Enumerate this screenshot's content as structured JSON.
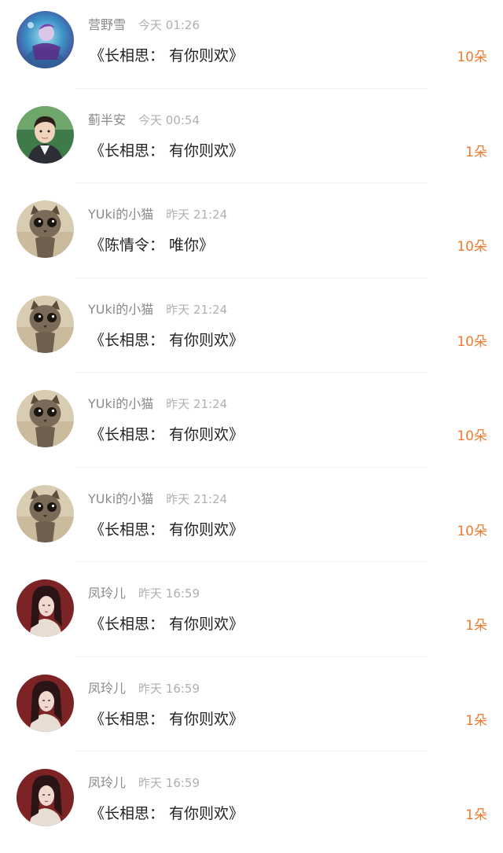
{
  "colors": {
    "accent": "#ee7b2e",
    "name": "#8a8a8a",
    "time": "#b0b0b0",
    "title": "#222222"
  },
  "items": [
    {
      "name": "营野雪",
      "time": "今天  01:26",
      "title": "《长相思： 有你则欢》",
      "count": "10朵",
      "avatar": "fantasy-character-avatar"
    },
    {
      "name": "蓟半安",
      "time": "今天  00:54",
      "title": "《长相思： 有你则欢》",
      "count": "1朵",
      "avatar": "young-man-avatar"
    },
    {
      "name": "YUki的小猫",
      "time": "昨天  21:24",
      "title": "《陈情令： 唯你》",
      "count": "10朵",
      "avatar": "cat-avatar"
    },
    {
      "name": "YUki的小猫",
      "time": "昨天  21:24",
      "title": "《长相思： 有你则欢》",
      "count": "10朵",
      "avatar": "cat-avatar"
    },
    {
      "name": "YUki的小猫",
      "time": "昨天  21:24",
      "title": "《长相思： 有你则欢》",
      "count": "10朵",
      "avatar": "cat-avatar"
    },
    {
      "name": "YUki的小猫",
      "time": "昨天  21:24",
      "title": "《长相思： 有你则欢》",
      "count": "10朵",
      "avatar": "cat-avatar"
    },
    {
      "name": "凤玲儿",
      "time": "昨天  16:59",
      "title": "《长相思： 有你则欢》",
      "count": "1朵",
      "avatar": "illustrated-woman-avatar"
    },
    {
      "name": "凤玲儿",
      "time": "昨天  16:59",
      "title": "《长相思： 有你则欢》",
      "count": "1朵",
      "avatar": "illustrated-woman-avatar"
    },
    {
      "name": "凤玲儿",
      "time": "昨天  16:59",
      "title": "《长相思： 有你则欢》",
      "count": "1朵",
      "avatar": "illustrated-woman-avatar"
    }
  ]
}
